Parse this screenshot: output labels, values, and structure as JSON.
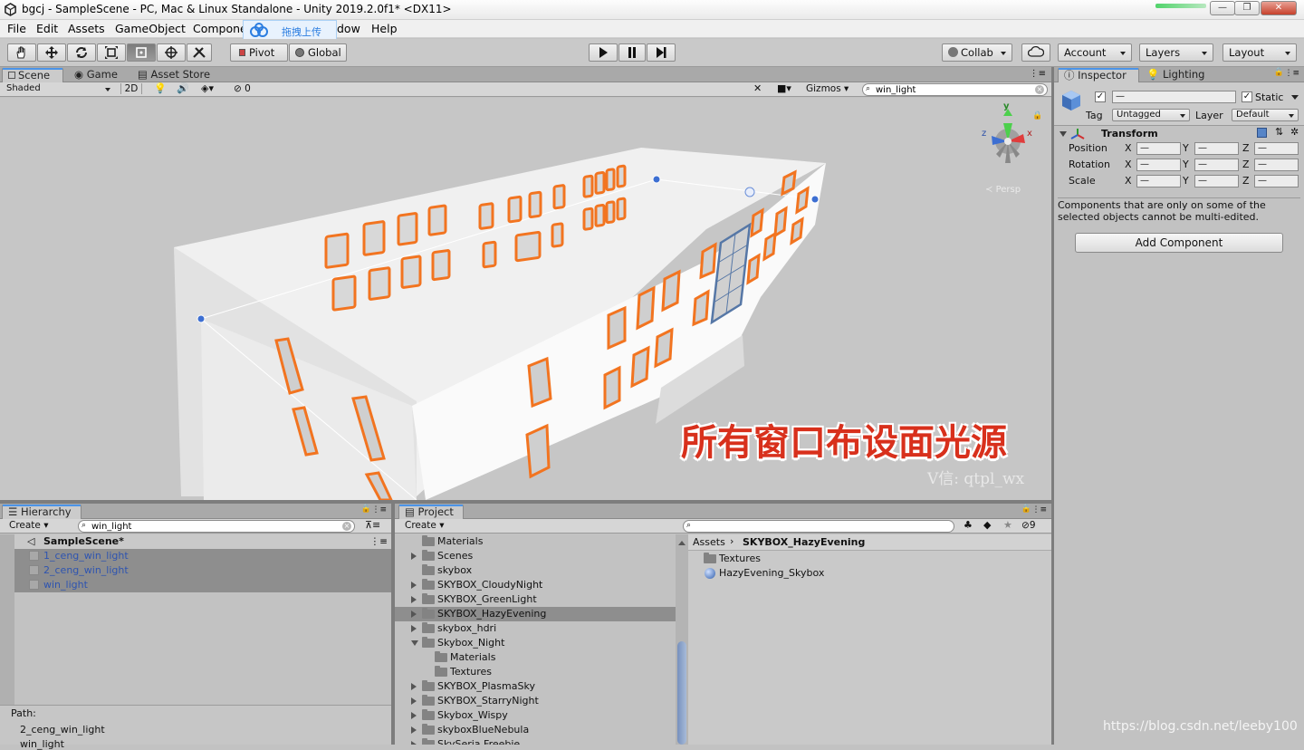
{
  "window": {
    "title": "bgcj - SampleScene - PC, Mac & Linux Standalone - Unity 2019.2.0f1* <DX11>",
    "minimize": "—",
    "maximize": "❐",
    "close": "✕"
  },
  "menu": [
    "File",
    "Edit",
    "Assets",
    "GameObject",
    "Compone",
    "dow",
    "Help"
  ],
  "upload_overlay": {
    "label": "拖拽上传"
  },
  "toolbar": {
    "pivot": "Pivot",
    "global": "Global",
    "collab": "Collab",
    "account": "Account",
    "layers": "Layers",
    "layout": "Layout"
  },
  "scene_panel": {
    "tabs": [
      "Scene",
      "Game",
      "Asset Store"
    ],
    "shading": "Shaded",
    "mode_2d": "2D",
    "hidden_count": "0",
    "gizmos": "Gizmos",
    "search_value": "win_light",
    "persp_label": "Persp",
    "axes": {
      "y": "y",
      "z": "z",
      "x": "x"
    },
    "overlay_caption": "所有窗口布设面光源",
    "watermark": "V信: qtpl_wx"
  },
  "hierarchy": {
    "tab": "Hierarchy",
    "create": "Create",
    "search_value": "win_light",
    "scene_name": "SampleScene*",
    "items": [
      "1_ceng_win_light",
      "2_ceng_win_light",
      "win_light"
    ],
    "path_label": "Path:",
    "path_lines": [
      "2_ceng_win_light",
      "win_light"
    ]
  },
  "project": {
    "tab": "Project",
    "create": "Create",
    "hidden_count": "9",
    "tree": [
      {
        "label": "Materials",
        "arrow": "none",
        "indent": 0
      },
      {
        "label": "Scenes",
        "arrow": "right",
        "indent": 0
      },
      {
        "label": "skybox",
        "arrow": "none",
        "indent": 0
      },
      {
        "label": "SKYBOX_CloudyNight",
        "arrow": "right",
        "indent": 0
      },
      {
        "label": "SKYBOX_GreenLight",
        "arrow": "right",
        "indent": 0
      },
      {
        "label": "SKYBOX_HazyEvening",
        "arrow": "right",
        "indent": 0,
        "selected": true
      },
      {
        "label": "skybox_hdri",
        "arrow": "right",
        "indent": 0
      },
      {
        "label": "Skybox_Night",
        "arrow": "down",
        "indent": 0
      },
      {
        "label": "Materials",
        "arrow": "none",
        "indent": 1
      },
      {
        "label": "Textures",
        "arrow": "none",
        "indent": 1
      },
      {
        "label": "SKYBOX_PlasmaSky",
        "arrow": "right",
        "indent": 0
      },
      {
        "label": "SKYBOX_StarryNight",
        "arrow": "right",
        "indent": 0
      },
      {
        "label": "Skybox_Wispy",
        "arrow": "right",
        "indent": 0
      },
      {
        "label": "skyboxBlueNebula",
        "arrow": "right",
        "indent": 0
      },
      {
        "label": "SkySeria Freebie",
        "arrow": "right",
        "indent": 0
      }
    ],
    "breadcrumb": {
      "root": "Assets",
      "current": "SKYBOX_HazyEvening"
    },
    "content": [
      {
        "label": "Textures",
        "icon": "folder"
      },
      {
        "label": "HazyEvening_Skybox",
        "icon": "material-sphere"
      }
    ]
  },
  "inspector": {
    "tabs": [
      "Inspector",
      "Lighting"
    ],
    "name_value": "—",
    "static_label": "Static",
    "tag_label": "Tag",
    "tag_value": "Untagged",
    "layer_label": "Layer",
    "layer_value": "Default",
    "transform_title": "Transform",
    "rows": [
      {
        "label": "Position",
        "x": "—",
        "y": "—",
        "z": "—"
      },
      {
        "label": "Rotation",
        "x": "—",
        "y": "—",
        "z": "—"
      },
      {
        "label": "Scale",
        "x": "—",
        "y": "—",
        "z": "—"
      }
    ],
    "axis_labels": [
      "X",
      "Y",
      "Z"
    ],
    "note": "Components that are only on some of the selected objects cannot be multi-edited.",
    "add_component": "Add Component"
  },
  "footer_watermark": "https://blog.csdn.net/leeby100"
}
